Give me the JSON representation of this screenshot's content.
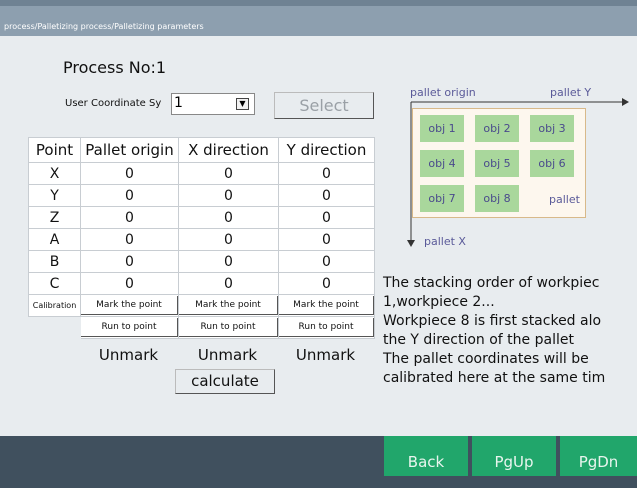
{
  "breadcrumb": "process/Palletizing process/Palletizing parameters",
  "process_label": "Process No:1",
  "ucs": {
    "label": "User Coordinate Sy",
    "value": "1",
    "select_label": "Select"
  },
  "table": {
    "headers": [
      "Point",
      "Pallet origin",
      "X direction",
      "Y direction"
    ],
    "rows": [
      [
        "X",
        "0",
        "0",
        "0"
      ],
      [
        "Y",
        "0",
        "0",
        "0"
      ],
      [
        "Z",
        "0",
        "0",
        "0"
      ],
      [
        "A",
        "0",
        "0",
        "0"
      ],
      [
        "B",
        "0",
        "0",
        "0"
      ],
      [
        "C",
        "0",
        "0",
        "0"
      ]
    ],
    "calibration_label": "Calibration",
    "mark_label": "Mark the point",
    "run_label": "Run to point",
    "unmark_label": "Unmark",
    "calculate_label": "calculate"
  },
  "diagram": {
    "pallet_origin": "pallet origin",
    "pallet_y": "pallet Y",
    "pallet_x": "pallet X",
    "pallet": "pallet",
    "objects": [
      "obj 1",
      "obj 2",
      "obj 3",
      "obj 4",
      "obj 5",
      "obj 6",
      "obj 7",
      "obj 8"
    ]
  },
  "info_lines": [
    "The stacking order of workpiec",
    "1,workpiece 2...",
    "Workpiece 8 is first stacked alo",
    "the Y direction of the pallet",
    "The pallet coordinates will be",
    "calibrated here at the same tim"
  ],
  "nav": {
    "back": "Back",
    "pgup": "PgUp",
    "pgdn": "PgDn"
  },
  "colors": {
    "nav_green": "#21a66b",
    "object_green": "#a9d79c",
    "pallet_border": "#d8b98a",
    "background_dark": "#40505e"
  }
}
